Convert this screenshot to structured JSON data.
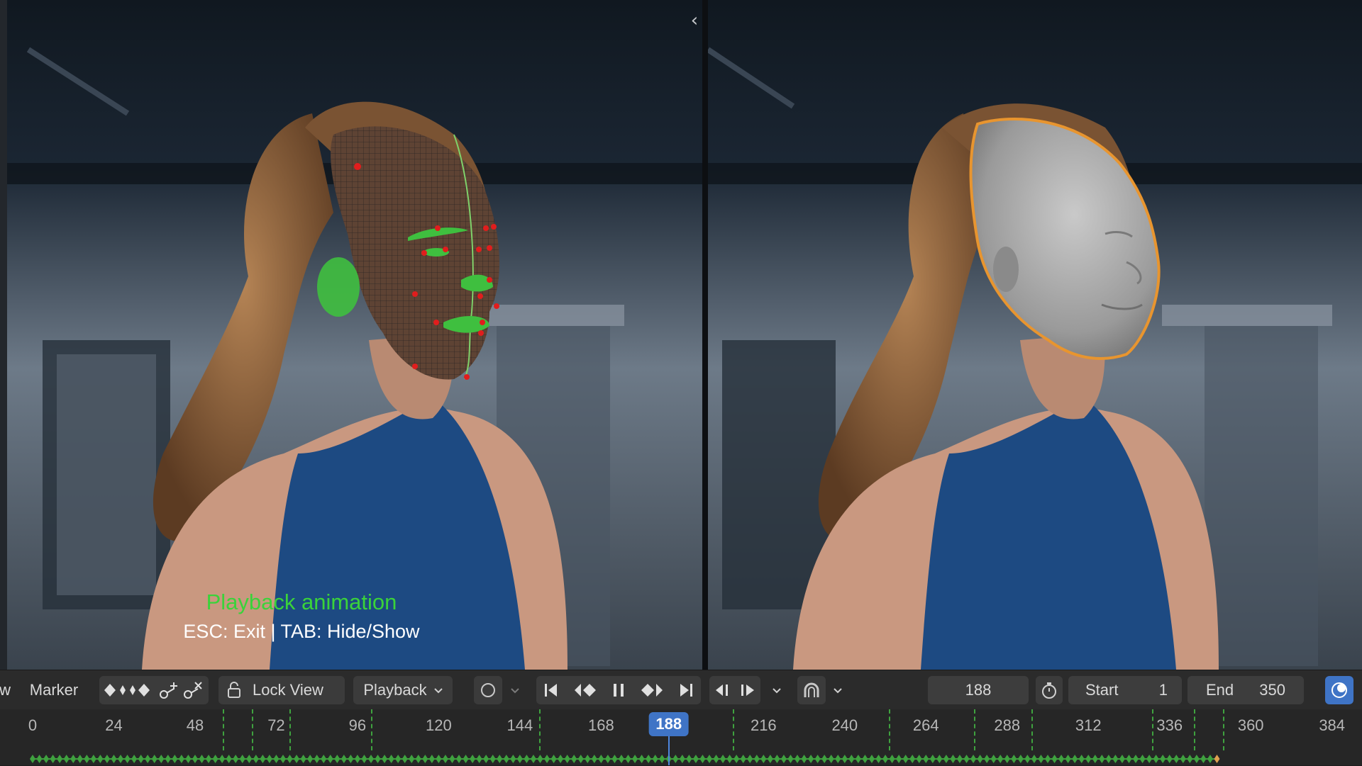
{
  "overlay": {
    "title": "Playback animation",
    "hint": "ESC: Exit | TAB: Hide/Show"
  },
  "toolbar": {
    "view_partial": "w",
    "marker_label": "Marker",
    "lock_view_label": "Lock View",
    "playback_label": "Playback",
    "current_frame": "188",
    "start_label": "Start",
    "start_value": "1",
    "end_label": "End",
    "end_value": "350"
  },
  "timeline": {
    "ticks": [
      "0",
      "24",
      "48",
      "72",
      "96",
      "120",
      "144",
      "168",
      "188",
      "216",
      "240",
      "264",
      "288",
      "312",
      "336",
      "360",
      "384"
    ],
    "current_frame": "188",
    "frame_end": 350
  },
  "colors": {
    "overlay_title": "#3ad33a",
    "playhead": "#3f74c6",
    "marker_lines": "#3fa23f",
    "keyframes": "#3fa23f",
    "face_outline": "#e8952f"
  },
  "icons": {
    "keyframe_nav": "keyframe-diamonds-icon",
    "key_add": "key-add-icon",
    "key_remove": "key-remove-icon",
    "lock": "lock-icon",
    "record": "record-icon",
    "jump_start": "jump-to-start-icon",
    "prev_keyframe": "previous-keyframe-icon",
    "pause": "pause-icon",
    "next_keyframe": "next-keyframe-icon",
    "jump_end": "jump-to-end-icon",
    "step_back": "step-back-icon",
    "step_forward": "step-forward-icon",
    "snap": "snap-magnet-icon",
    "timer": "stopwatch-icon",
    "overlay": "overlay-icon"
  }
}
